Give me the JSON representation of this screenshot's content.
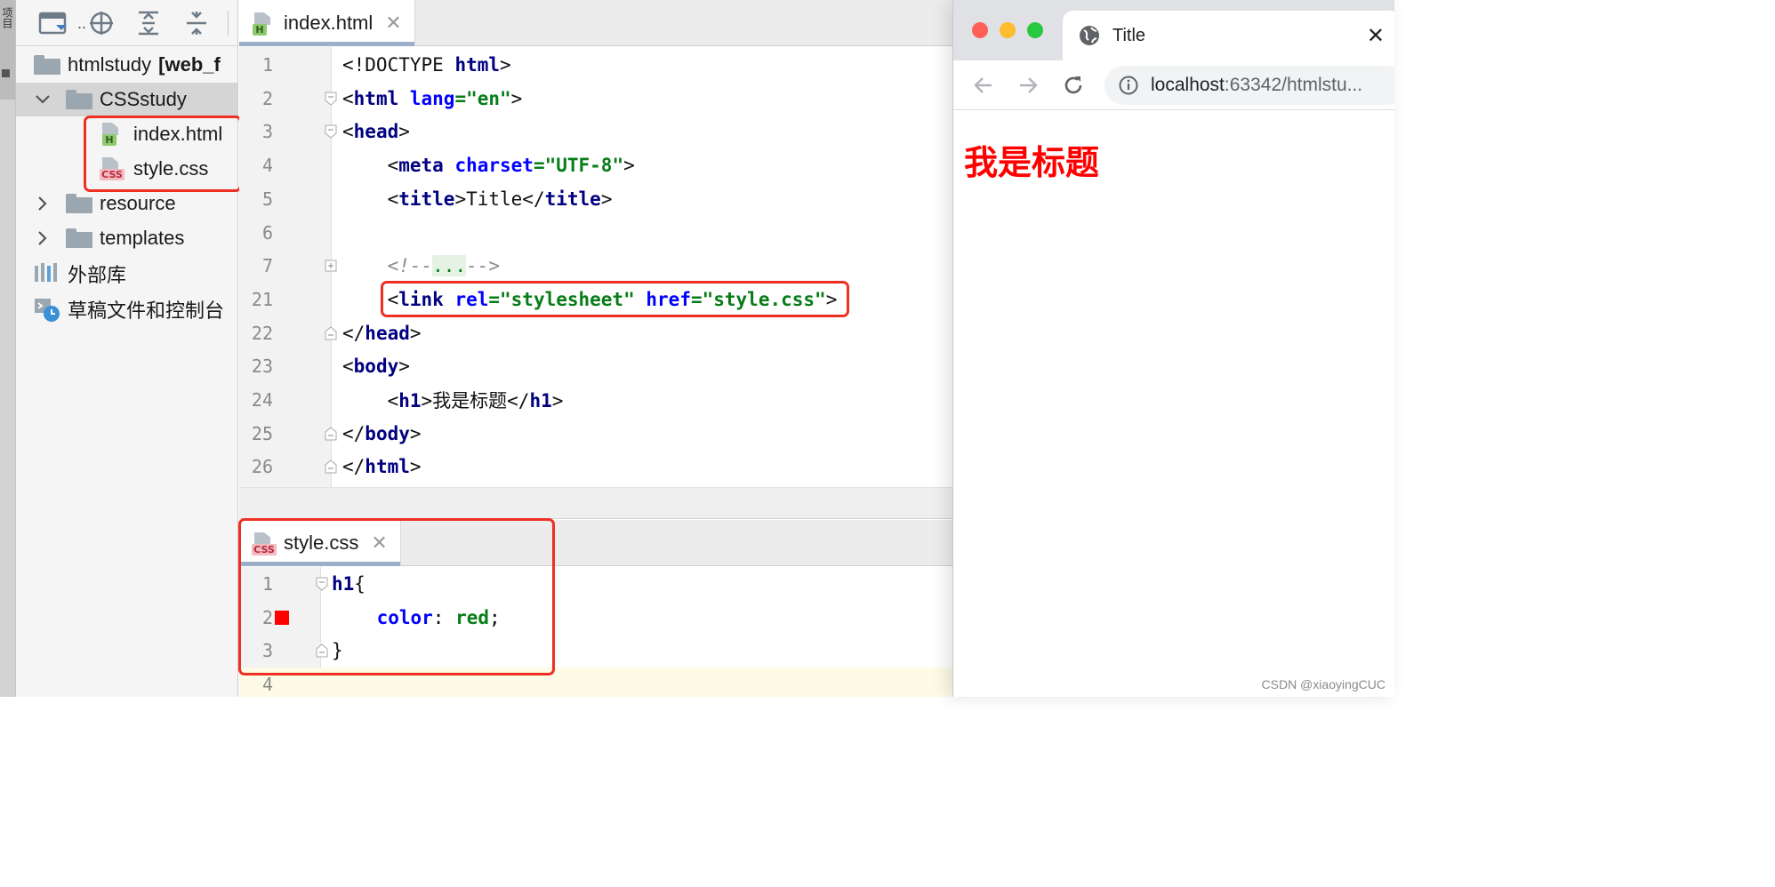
{
  "side_strip": {
    "label": "项目"
  },
  "project": {
    "root": {
      "name": "htmlstudy",
      "bracket": "[web_f"
    },
    "items": [
      {
        "label": "CSSstudy",
        "type": "folder",
        "expanded": true
      },
      {
        "label": "index.html",
        "type": "html-file"
      },
      {
        "label": "style.css",
        "type": "css-file"
      },
      {
        "label": "resource",
        "type": "folder",
        "expanded": false
      },
      {
        "label": "templates",
        "type": "folder",
        "expanded": false
      },
      {
        "label": "外部库",
        "type": "library"
      },
      {
        "label": "草稿文件和控制台",
        "type": "scratches"
      }
    ],
    "toolbar_dots": ".."
  },
  "editor": {
    "tab": {
      "label": "index.html",
      "badge": "H"
    },
    "lines": [
      {
        "num": "1",
        "parts": [
          [
            "plain",
            "<!DOCTYPE "
          ],
          [
            "tag",
            "html"
          ],
          [
            "plain",
            ">"
          ]
        ]
      },
      {
        "num": "2",
        "parts": [
          [
            "plain",
            "<"
          ],
          [
            "tag",
            "html "
          ],
          [
            "attr",
            "lang"
          ],
          [
            "str",
            "=\"en\""
          ],
          [
            "plain",
            ">"
          ]
        ]
      },
      {
        "num": "3",
        "parts": [
          [
            "plain",
            "<"
          ],
          [
            "tag",
            "head"
          ],
          [
            "plain",
            ">"
          ]
        ]
      },
      {
        "num": "4",
        "parts": [
          [
            "plain",
            "    <"
          ],
          [
            "tag",
            "meta "
          ],
          [
            "attr",
            "charset"
          ],
          [
            "str",
            "=\"UTF-8\""
          ],
          [
            "plain",
            ">"
          ]
        ]
      },
      {
        "num": "5",
        "parts": [
          [
            "plain",
            "    <"
          ],
          [
            "tag",
            "title"
          ],
          [
            "plain",
            ">Title</"
          ],
          [
            "tag",
            "title"
          ],
          [
            "plain",
            ">"
          ]
        ]
      },
      {
        "num": "6",
        "parts": []
      },
      {
        "num": "7",
        "parts": [
          [
            "comment",
            "    <!--"
          ],
          [
            "fold",
            "..."
          ],
          [
            "comment",
            "-->"
          ]
        ]
      },
      {
        "num": "21",
        "parts": [
          [
            "plain",
            "    <"
          ],
          [
            "tag",
            "link "
          ],
          [
            "attr",
            "rel"
          ],
          [
            "str",
            "=\"stylesheet\" "
          ],
          [
            "attr",
            "href"
          ],
          [
            "str",
            "=\"style.css\""
          ],
          [
            "plain",
            ">"
          ]
        ]
      },
      {
        "num": "22",
        "parts": [
          [
            "plain",
            "</"
          ],
          [
            "tag",
            "head"
          ],
          [
            "plain",
            ">"
          ]
        ]
      },
      {
        "num": "23",
        "parts": [
          [
            "plain",
            "<"
          ],
          [
            "tag",
            "body"
          ],
          [
            "plain",
            ">"
          ]
        ]
      },
      {
        "num": "24",
        "parts": [
          [
            "plain",
            "    <"
          ],
          [
            "tag",
            "h1"
          ],
          [
            "plain",
            ">我是标题</"
          ],
          [
            "tag",
            "h1"
          ],
          [
            "plain",
            ">"
          ]
        ]
      },
      {
        "num": "25",
        "parts": [
          [
            "plain",
            "</"
          ],
          [
            "tag",
            "body"
          ],
          [
            "plain",
            ">"
          ]
        ]
      },
      {
        "num": "26",
        "parts": [
          [
            "plain",
            "</"
          ],
          [
            "tag",
            "html"
          ],
          [
            "plain",
            ">"
          ]
        ]
      }
    ]
  },
  "css_editor": {
    "tab": {
      "label": "style.css",
      "badge": "CSS"
    },
    "lines": [
      {
        "num": "1",
        "parts": [
          [
            "css-sel",
            "h1"
          ],
          [
            "plain",
            "{"
          ]
        ]
      },
      {
        "num": "2",
        "parts": [
          [
            "plain",
            "    "
          ],
          [
            "css-prop",
            "color"
          ],
          [
            "plain",
            ": "
          ],
          [
            "css-val",
            "red"
          ],
          [
            "plain",
            ";"
          ]
        ]
      },
      {
        "num": "3",
        "parts": [
          [
            "plain",
            "}"
          ]
        ]
      },
      {
        "num": "4",
        "parts": []
      }
    ],
    "swatch_color": "#ff0000"
  },
  "browser": {
    "tab_title": "Title",
    "url_host": "localhost",
    "url_rest": ":63342/htmlstu...",
    "h1_text": "我是标题",
    "h1_color": "#ff0000"
  },
  "watermark": "CSDN @xiaoyingCUC",
  "colors": {
    "highlight_red": "#ef2f22",
    "tag": "#000080",
    "attr": "#0000ff",
    "string": "#067d17"
  }
}
